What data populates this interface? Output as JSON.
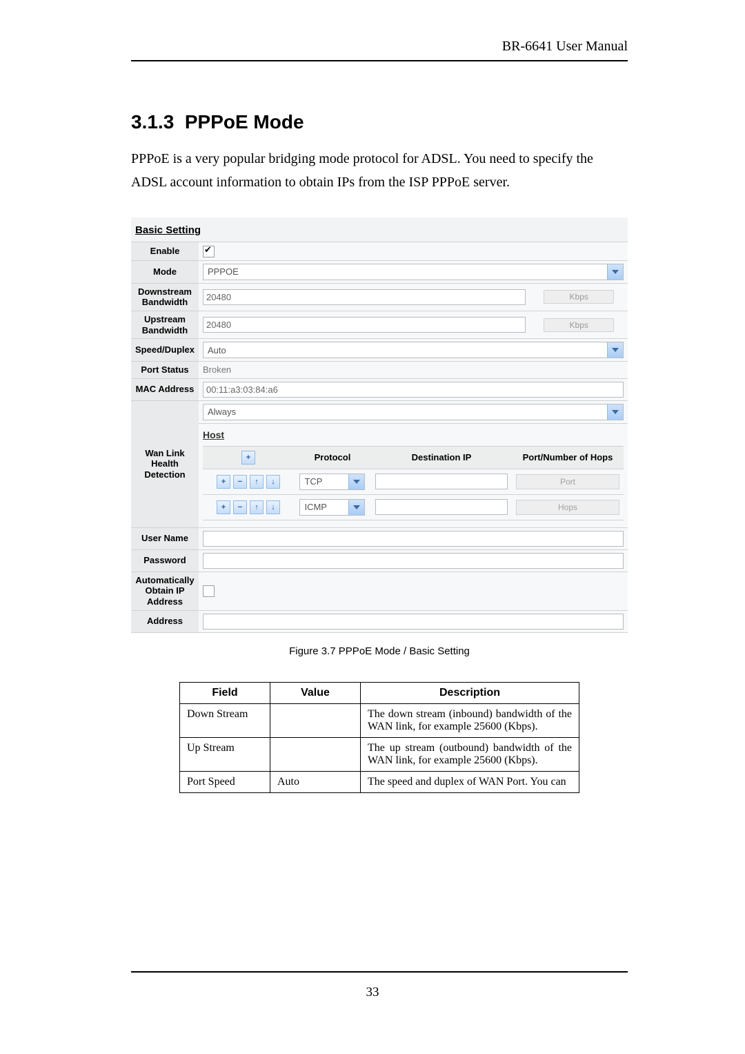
{
  "header": {
    "running_head": "BR-6641 User Manual"
  },
  "section": {
    "number": "3.1.3",
    "title": "PPPoE Mode",
    "paragraph": "PPPoE is a very popular bridging mode protocol for ADSL. You need to specify the ADSL account information to obtain IPs from the ISP PPPoE server."
  },
  "settings": {
    "group_title": "Basic Setting",
    "labels": {
      "enable": "Enable",
      "mode": "Mode",
      "down_bw": "Downstream Bandwidth",
      "up_bw": "Upstream Bandwidth",
      "speed_duplex": "Speed/Duplex",
      "port_status": "Port Status",
      "mac": "MAC Address",
      "wan_link": "Wan Link Health Detection",
      "host": "Host",
      "user_name": "User Name",
      "password": "Password",
      "auto_ip": "Automatically Obtain IP Address",
      "address": "Address"
    },
    "values": {
      "enable_checked": true,
      "mode": "PPPOE",
      "down_bw": "20480",
      "up_bw": "20480",
      "kbps": "Kbps",
      "speed_duplex": "Auto",
      "port_status": "Broken",
      "mac": "00:11:a3:03:84:a6",
      "wan_link": "Always",
      "auto_ip_checked": false
    },
    "host_table": {
      "headers": {
        "add": "",
        "protocol": "Protocol",
        "dest_ip": "Destination IP",
        "port_hops": "Port/Number of Hops"
      },
      "rows": [
        {
          "protocol": "TCP",
          "dest_ip": "",
          "port_hops_ph": "Port"
        },
        {
          "protocol": "ICMP",
          "dest_ip": "",
          "port_hops_ph": "Hops"
        }
      ],
      "mini_buttons": {
        "plus": "+",
        "minus": "−",
        "up": "↑",
        "down": "↓"
      }
    }
  },
  "figure_caption": "Figure 3.7   PPPoE Mode / Basic Setting",
  "desc_table": {
    "headers": {
      "field": "Field",
      "value": "Value",
      "desc": "Description"
    },
    "rows": [
      {
        "field": "Down Stream",
        "value": "",
        "desc": "The down stream (inbound) bandwidth of the WAN link, for example 25600 (Kbps)."
      },
      {
        "field": "Up Stream",
        "value": "",
        "desc": "The up stream (outbound) bandwidth of the WAN link, for example 25600 (Kbps)."
      },
      {
        "field": "Port Speed",
        "value": "Auto",
        "desc": "The speed and duplex of WAN Port. You can"
      }
    ]
  },
  "page_number": "33"
}
